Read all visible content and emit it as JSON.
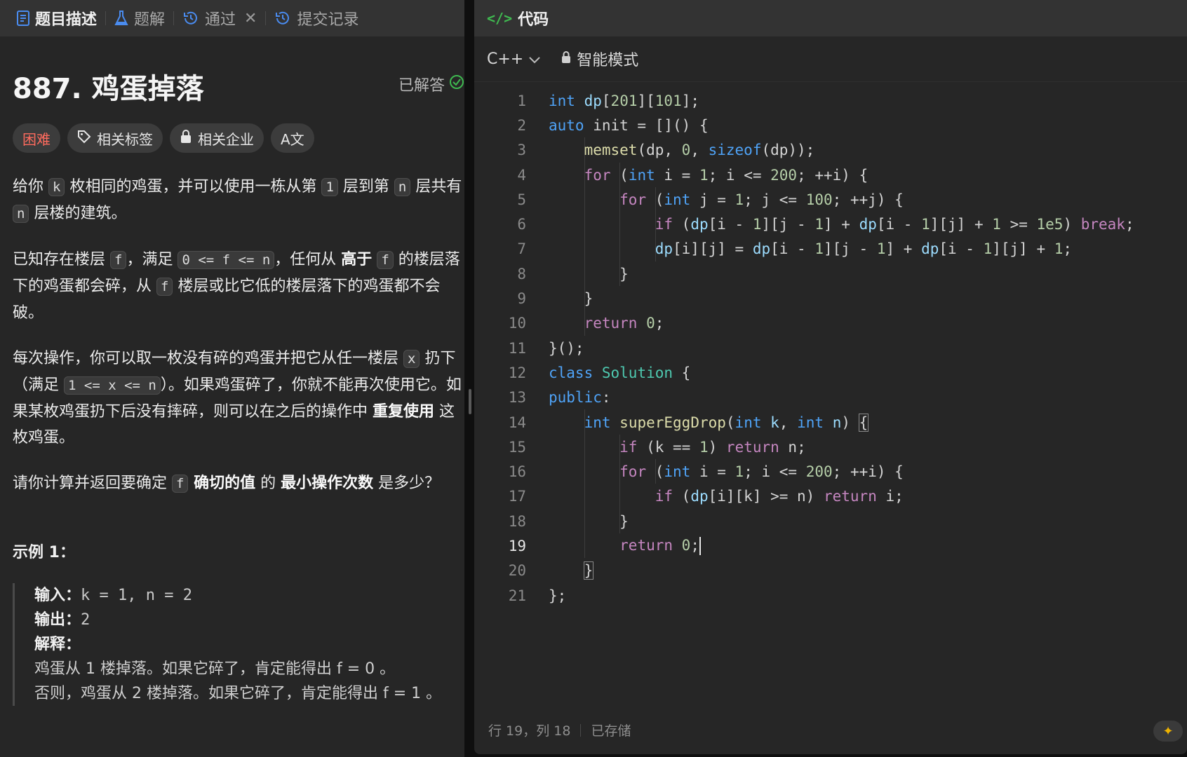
{
  "tabs": [
    {
      "label": "题目描述"
    },
    {
      "label": "题解"
    },
    {
      "label": "通过"
    },
    {
      "label": "提交记录"
    }
  ],
  "problem": {
    "title": "887. 鸡蛋掉落",
    "status": "已解答",
    "chips": {
      "difficulty": "困难",
      "tags": "相关标签",
      "companies": "相关企业",
      "translate": "A文"
    },
    "p1": {
      "a": "给你 ",
      "k": "k",
      "b": " 枚相同的鸡蛋，并可以使用一栋从第 ",
      "one": "1",
      "c": " 层到第 ",
      "n": "n",
      "d": " 层共有 ",
      "n2": "n",
      "e": " 层楼的建筑。"
    },
    "p2": {
      "a": "已知存在楼层 ",
      "f": "f",
      "b": "，满足 ",
      "range": "0 <= f <= n",
      "c": "，任何从 ",
      "bold": "高于",
      "d": " ",
      "f2": "f",
      "e": " 的楼层落下的鸡蛋都会碎，从 ",
      "f3": "f",
      "g": " 楼层或比它低的楼层落下的鸡蛋都不会破。"
    },
    "p3": {
      "a": "每次操作，你可以取一枚没有碎的鸡蛋并把它从任一楼层 ",
      "x": "x",
      "b": " 扔下（满足 ",
      "range": "1 <= x <= n",
      "c": "）。如果鸡蛋碎了，你就不能再次使用它。如果某枚鸡蛋扔下后没有摔碎，则可以在之后的操作中 ",
      "bold": "重复使用",
      "d": " 这枚鸡蛋。"
    },
    "p4": {
      "a": "请你计算并返回要确定 ",
      "f": "f",
      "bold1": " 确切的值",
      "b": " 的 ",
      "bold2": "最小操作次数",
      "c": " 是多少？"
    },
    "example": {
      "title": "示例 1：",
      "input_label": "输入：",
      "input": "k = 1, n = 2",
      "output_label": "输出：",
      "output": "2",
      "explain_label": "解释：",
      "line1": "鸡蛋从 1 楼掉落。如果它碎了，肯定能得出 f = 0 。",
      "line2": "否则，鸡蛋从 2 楼掉落。如果它碎了，肯定能得出 f = 1 。"
    }
  },
  "editor": {
    "header": "代码",
    "language": "C++",
    "mode": "智能模式",
    "current_line": 19,
    "status_position": "行 19，列 18",
    "status_saved": "已存储",
    "lines": [
      "int dp[201][101];",
      "auto init = []() {",
      "    memset(dp, 0, sizeof(dp));",
      "    for (int i = 1; i <= 200; ++i) {",
      "        for (int j = 1; j <= 100; ++j) {",
      "            if (dp[i - 1][j - 1] + dp[i - 1][j] + 1 >= 1e5) break;",
      "            dp[i][j] = dp[i - 1][j - 1] + dp[i - 1][j] + 1;",
      "        }",
      "    }",
      "    return 0;",
      "}();",
      "class Solution {",
      "public:",
      "    int superEggDrop(int k, int n) {",
      "        if (k == 1) return n;",
      "        for (int i = 1; i <= 200; ++i) {",
      "            if (dp[i][k] >= n) return i;",
      "        }",
      "        return 0;",
      "    }",
      "};"
    ]
  }
}
